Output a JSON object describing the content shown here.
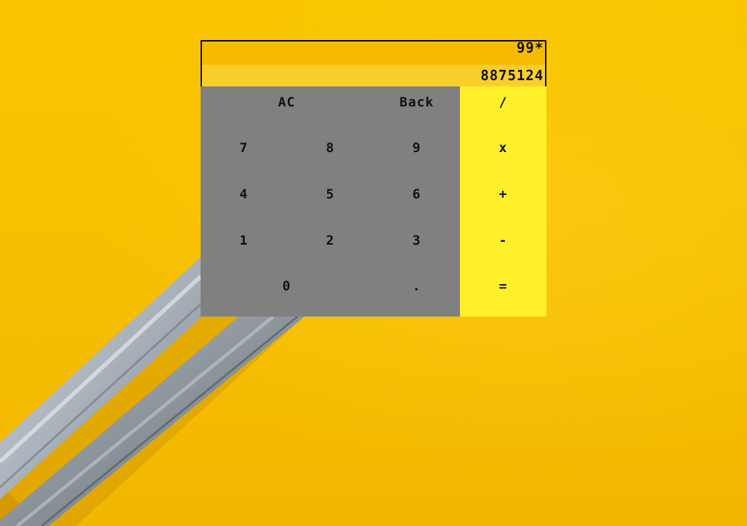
{
  "display": {
    "expression": "99*",
    "result": "8875124"
  },
  "keys": {
    "ac": "AC",
    "back": "Back",
    "seven": "7",
    "eight": "8",
    "nine": "9",
    "four": "4",
    "five": "5",
    "six": "6",
    "one": "1",
    "two": "2",
    "three": "3",
    "zero": "0",
    "dot": "."
  },
  "operators": {
    "divide": "/",
    "multiply": "x",
    "add": "+",
    "subtract": "-",
    "equals": "="
  },
  "colors": {
    "background": "#f6bf00",
    "expression_bg": "#f6bc00",
    "result_bg": "#f8cf2a",
    "keypad_bg": "#808080",
    "operators_bg": "#fff02a"
  }
}
